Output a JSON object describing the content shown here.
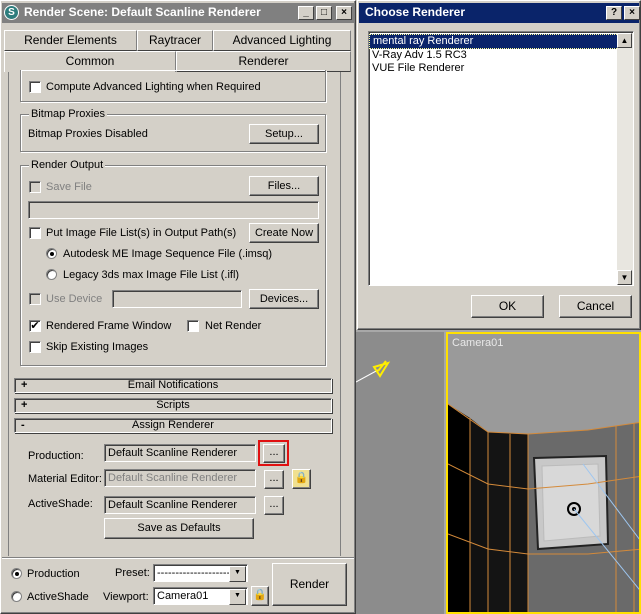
{
  "render_scene": {
    "title": "Render Scene: Default Scanline Renderer",
    "tabs_row1": [
      "Render Elements",
      "Raytracer",
      "Advanced Lighting"
    ],
    "tabs_row2": [
      "Common",
      "Renderer"
    ],
    "compute_adv_lighting": "Compute Advanced Lighting when Required",
    "bitmap_proxies": {
      "group": "Bitmap Proxies",
      "status": "Bitmap Proxies Disabled",
      "setup": "Setup..."
    },
    "render_output": {
      "group": "Render Output",
      "save_file": "Save File",
      "files": "Files...",
      "path_value": "",
      "put_image_list": "Put Image File List(s) in Output Path(s)",
      "create_now": "Create Now",
      "radio1": "Autodesk ME Image Sequence File (.imsq)",
      "radio2": "Legacy 3ds max Image File List (.ifl)",
      "use_device": "Use Device",
      "devices": "Devices...",
      "rendered_frame_window": "Rendered Frame Window",
      "net_render": "Net Render",
      "skip_existing": "Skip Existing Images"
    },
    "rollouts": [
      {
        "sign": "+",
        "label": "Email Notifications"
      },
      {
        "sign": "+",
        "label": "Scripts"
      },
      {
        "sign": "-",
        "label": "Assign Renderer"
      }
    ],
    "assign": {
      "production_label": "Production:",
      "production_value": "Default Scanline Renderer",
      "material_label": "Material Editor:",
      "material_value": "Default Scanline Renderer",
      "activeshade_label": "ActiveShade:",
      "activeshade_value": "Default Scanline Renderer",
      "browse": "...",
      "save_defaults": "Save as Defaults"
    },
    "bottom": {
      "production": "Production",
      "activeshade": "ActiveShade",
      "preset_label": "Preset:",
      "preset_value": "----------------------",
      "viewport_label": "Viewport:",
      "viewport_value": "Camera01",
      "render": "Render"
    }
  },
  "choose_renderer": {
    "title": "Choose Renderer",
    "items": [
      "mental ray Renderer",
      "V-Ray Adv 1.5 RC3",
      "VUE File Renderer"
    ],
    "ok": "OK",
    "cancel": "Cancel"
  },
  "viewport": {
    "label": "Camera01"
  }
}
